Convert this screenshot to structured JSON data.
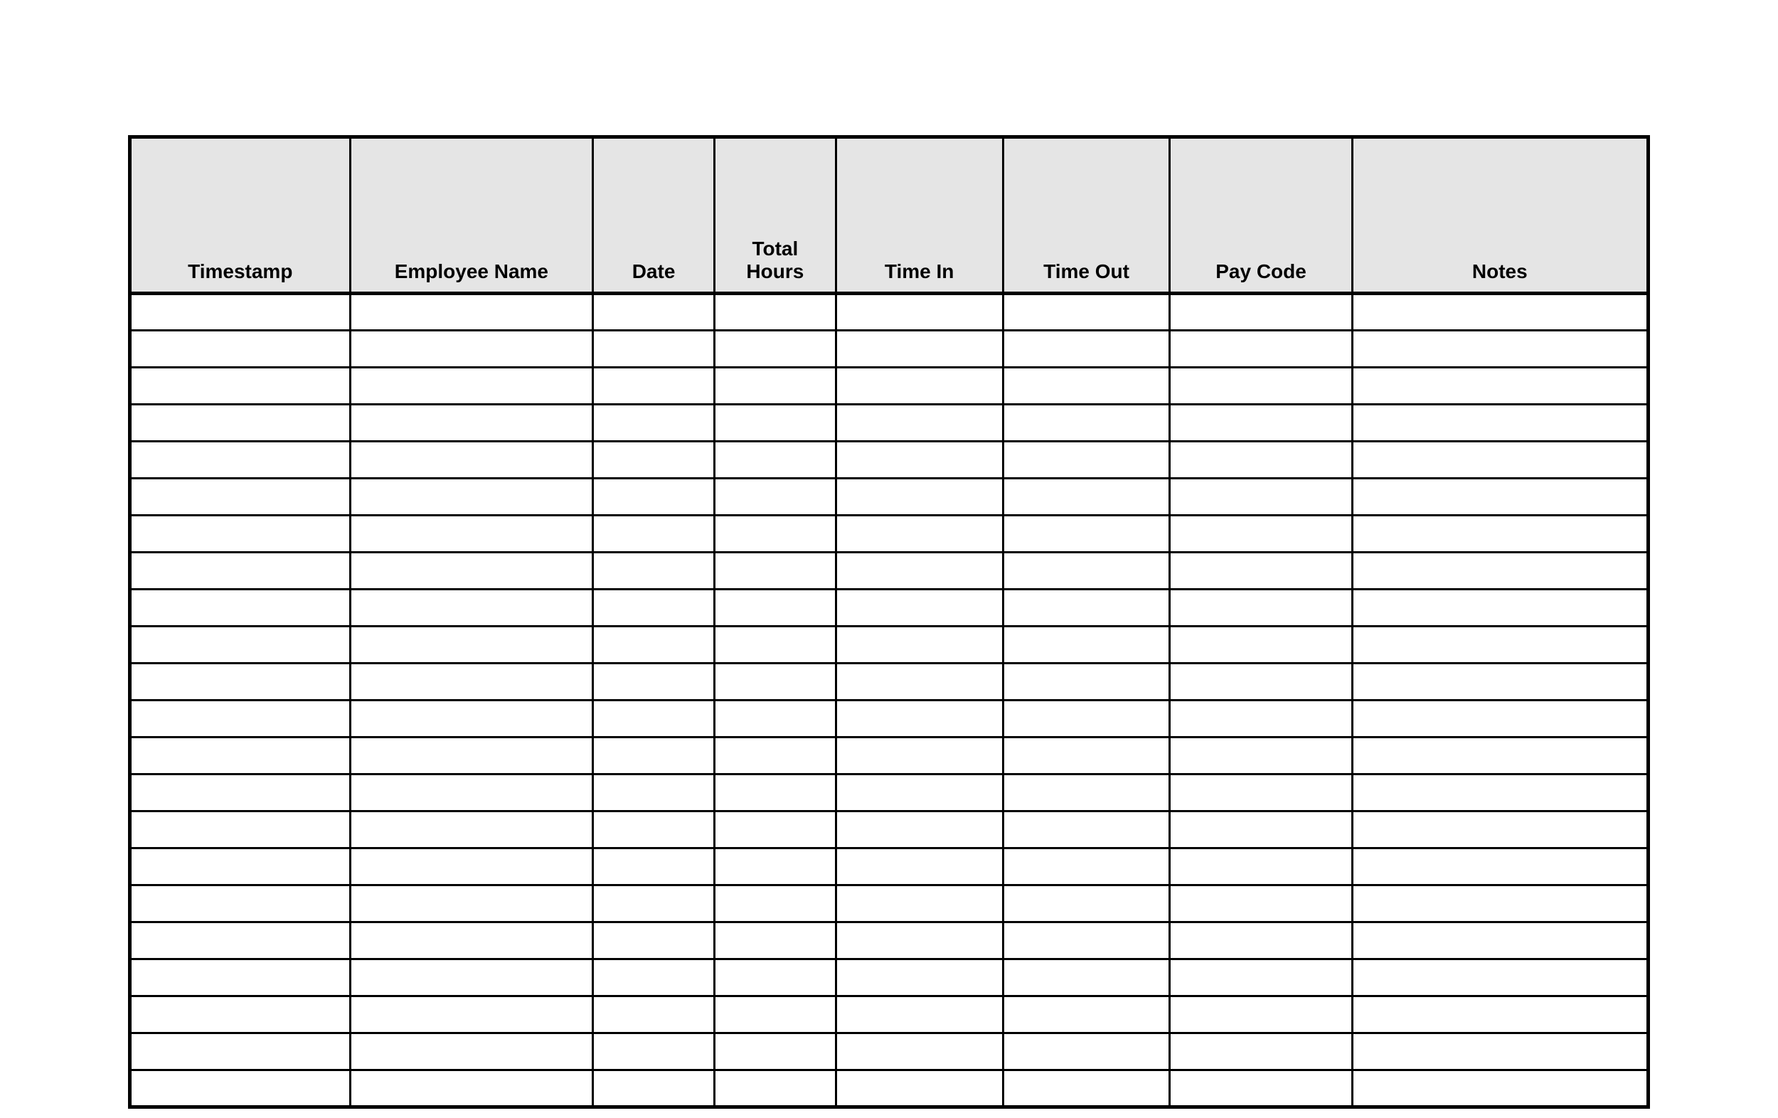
{
  "table": {
    "columns": [
      {
        "key": "timestamp",
        "label": "Timestamp"
      },
      {
        "key": "employee",
        "label": "Employee Name"
      },
      {
        "key": "date",
        "label": "Date"
      },
      {
        "key": "total",
        "label": "Total\nHours"
      },
      {
        "key": "timein",
        "label": "Time In"
      },
      {
        "key": "timeout",
        "label": "Time Out"
      },
      {
        "key": "paycode",
        "label": "Pay Code"
      },
      {
        "key": "notes",
        "label": "Notes"
      }
    ],
    "rows": [
      {
        "timestamp": "",
        "employee": "",
        "date": "",
        "total": "",
        "timein": "",
        "timeout": "",
        "paycode": "",
        "notes": ""
      },
      {
        "timestamp": "",
        "employee": "",
        "date": "",
        "total": "",
        "timein": "",
        "timeout": "",
        "paycode": "",
        "notes": ""
      },
      {
        "timestamp": "",
        "employee": "",
        "date": "",
        "total": "",
        "timein": "",
        "timeout": "",
        "paycode": "",
        "notes": ""
      },
      {
        "timestamp": "",
        "employee": "",
        "date": "",
        "total": "",
        "timein": "",
        "timeout": "",
        "paycode": "",
        "notes": ""
      },
      {
        "timestamp": "",
        "employee": "",
        "date": "",
        "total": "",
        "timein": "",
        "timeout": "",
        "paycode": "",
        "notes": ""
      },
      {
        "timestamp": "",
        "employee": "",
        "date": "",
        "total": "",
        "timein": "",
        "timeout": "",
        "paycode": "",
        "notes": ""
      },
      {
        "timestamp": "",
        "employee": "",
        "date": "",
        "total": "",
        "timein": "",
        "timeout": "",
        "paycode": "",
        "notes": ""
      },
      {
        "timestamp": "",
        "employee": "",
        "date": "",
        "total": "",
        "timein": "",
        "timeout": "",
        "paycode": "",
        "notes": ""
      },
      {
        "timestamp": "",
        "employee": "",
        "date": "",
        "total": "",
        "timein": "",
        "timeout": "",
        "paycode": "",
        "notes": ""
      },
      {
        "timestamp": "",
        "employee": "",
        "date": "",
        "total": "",
        "timein": "",
        "timeout": "",
        "paycode": "",
        "notes": ""
      },
      {
        "timestamp": "",
        "employee": "",
        "date": "",
        "total": "",
        "timein": "",
        "timeout": "",
        "paycode": "",
        "notes": ""
      },
      {
        "timestamp": "",
        "employee": "",
        "date": "",
        "total": "",
        "timein": "",
        "timeout": "",
        "paycode": "",
        "notes": ""
      },
      {
        "timestamp": "",
        "employee": "",
        "date": "",
        "total": "",
        "timein": "",
        "timeout": "",
        "paycode": "",
        "notes": ""
      },
      {
        "timestamp": "",
        "employee": "",
        "date": "",
        "total": "",
        "timein": "",
        "timeout": "",
        "paycode": "",
        "notes": ""
      },
      {
        "timestamp": "",
        "employee": "",
        "date": "",
        "total": "",
        "timein": "",
        "timeout": "",
        "paycode": "",
        "notes": ""
      },
      {
        "timestamp": "",
        "employee": "",
        "date": "",
        "total": "",
        "timein": "",
        "timeout": "",
        "paycode": "",
        "notes": ""
      },
      {
        "timestamp": "",
        "employee": "",
        "date": "",
        "total": "",
        "timein": "",
        "timeout": "",
        "paycode": "",
        "notes": ""
      },
      {
        "timestamp": "",
        "employee": "",
        "date": "",
        "total": "",
        "timein": "",
        "timeout": "",
        "paycode": "",
        "notes": ""
      },
      {
        "timestamp": "",
        "employee": "",
        "date": "",
        "total": "",
        "timein": "",
        "timeout": "",
        "paycode": "",
        "notes": ""
      },
      {
        "timestamp": "",
        "employee": "",
        "date": "",
        "total": "",
        "timein": "",
        "timeout": "",
        "paycode": "",
        "notes": ""
      },
      {
        "timestamp": "",
        "employee": "",
        "date": "",
        "total": "",
        "timein": "",
        "timeout": "",
        "paycode": "",
        "notes": ""
      },
      {
        "timestamp": "",
        "employee": "",
        "date": "",
        "total": "",
        "timein": "",
        "timeout": "",
        "paycode": "",
        "notes": ""
      }
    ]
  }
}
